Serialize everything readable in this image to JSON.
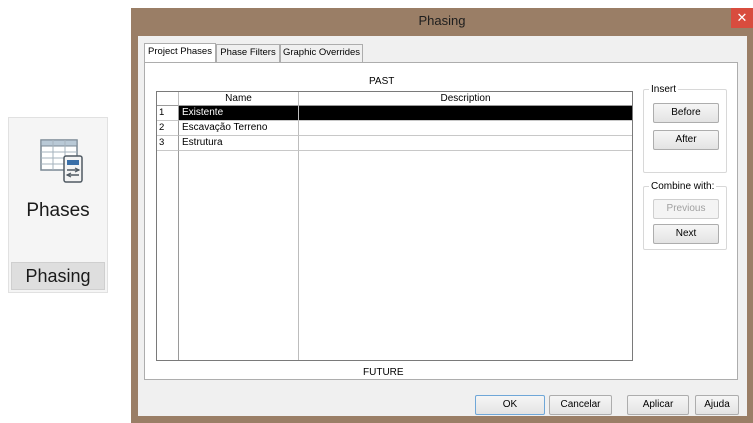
{
  "ribbon": {
    "button_label": "Phases",
    "panel_title": "Phasing",
    "icon": "phases-table-icon"
  },
  "dialog": {
    "title": "Phasing",
    "close_glyph": "✕",
    "tabs": [
      {
        "label": "Project Phases",
        "active": true
      },
      {
        "label": "Phase Filters",
        "active": false
      },
      {
        "label": "Graphic Overrides",
        "active": false
      }
    ],
    "past_label": "PAST",
    "future_label": "FUTURE",
    "table": {
      "columns": [
        "Name",
        "Description"
      ],
      "rows": [
        {
          "num": "1",
          "name": "Existente",
          "description": "",
          "selected": true
        },
        {
          "num": "2",
          "name": "Escavação Terreno",
          "description": "",
          "selected": false
        },
        {
          "num": "3",
          "name": "Estrutura",
          "description": "",
          "selected": false
        }
      ]
    },
    "insert": {
      "title": "Insert",
      "before_label": "Before",
      "after_label": "After"
    },
    "combine": {
      "title": "Combine with:",
      "previous_label": "Previous",
      "next_label": "Next",
      "previous_disabled": true
    },
    "footer": {
      "ok_label": "OK",
      "cancel_label": "Cancelar",
      "apply_label": "Aplicar",
      "help_label": "Ajuda"
    },
    "colors": {
      "title_bar": "#9a7e66",
      "close_button": "#d84c3e",
      "selection": "#000000"
    }
  }
}
